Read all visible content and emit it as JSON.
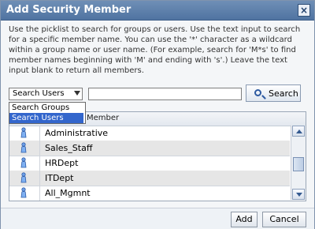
{
  "dialog": {
    "title": "Add Security Member",
    "close_icon": "close-icon"
  },
  "instructions": {
    "text": "Use the picklist to search for groups or users. Use the text input to search for a specific member name. You can use the '*' character as a wildcard within a group name or user name. (For example, search for 'M*s' to find member names beginning with 'M' and ending with 's'.) Leave the text input blank to return all members."
  },
  "filter": {
    "selected": "Search Users",
    "options": [
      "Search Groups",
      "Search Users"
    ],
    "search_value": "",
    "search_button": "Search"
  },
  "table": {
    "header_name": "Member",
    "rows": [
      {
        "name": "Administrative",
        "icon": "user-icon"
      },
      {
        "name": "Sales_Staff",
        "icon": "user-icon"
      },
      {
        "name": "HRDept",
        "icon": "user-icon"
      },
      {
        "name": "ITDept",
        "icon": "user-icon"
      },
      {
        "name": "All_Mgmnt",
        "icon": "user-icon"
      }
    ]
  },
  "footer": {
    "add": "Add",
    "cancel": "Cancel"
  }
}
